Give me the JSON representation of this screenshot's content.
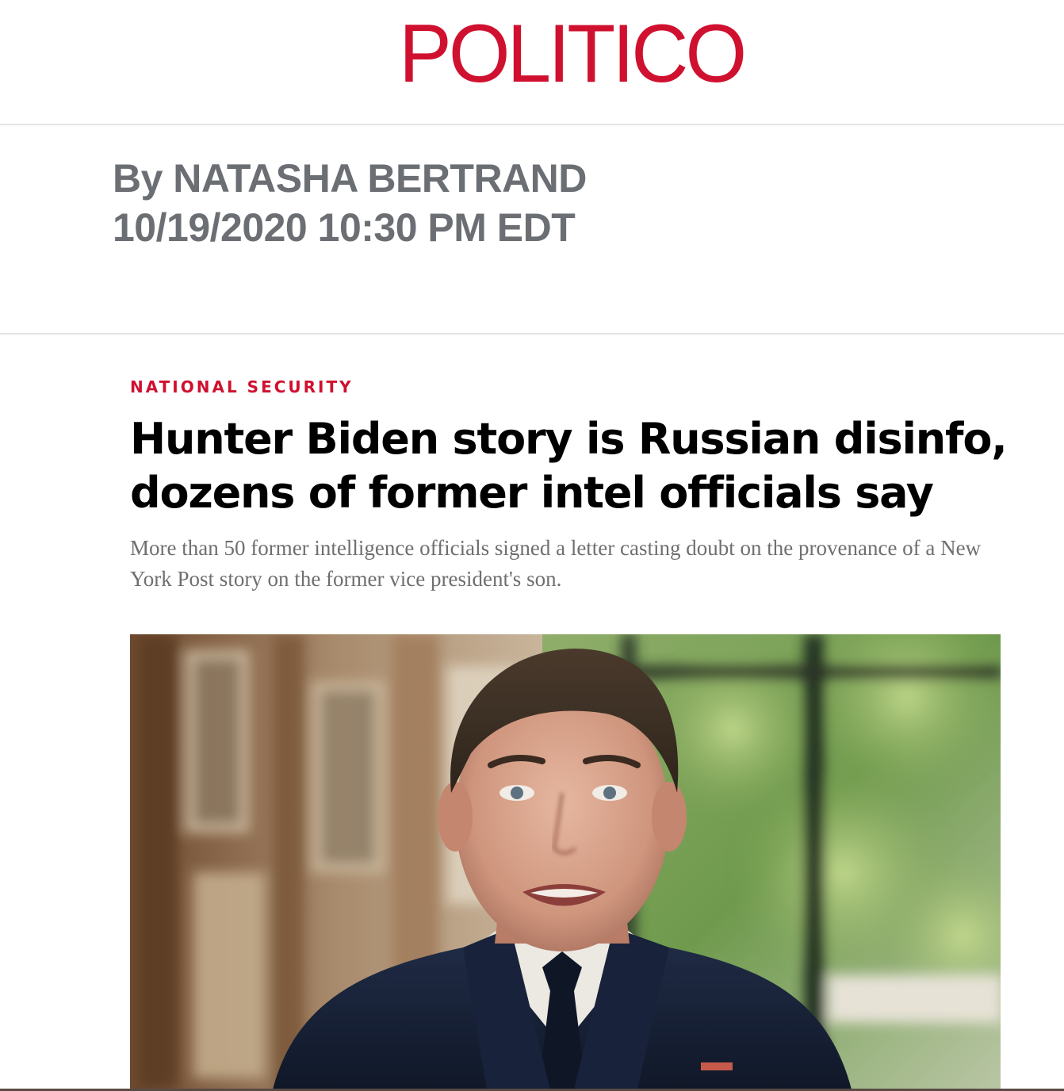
{
  "masthead": {
    "logo_text": "POLITICO",
    "brand_color": "#d0102f"
  },
  "byline": {
    "author": "By NATASHA BERTRAND",
    "timestamp": "10/19/2020 10:30 PM EDT"
  },
  "article": {
    "section": "NATIONAL SECURITY",
    "headline_line1": "Hunter Biden story is Russian disinfo,",
    "headline_line2": "dozens of former intel officials say",
    "dek": "More than 50 former intelligence officials signed a letter casting doubt on the provenance of a New York Post story on the former vice president's son.",
    "image_icon": "hero-photo"
  },
  "colors": {
    "byline_gray": "#6b6f74",
    "dek_gray": "#6f6f6f",
    "divider": "#e4e4e4"
  }
}
